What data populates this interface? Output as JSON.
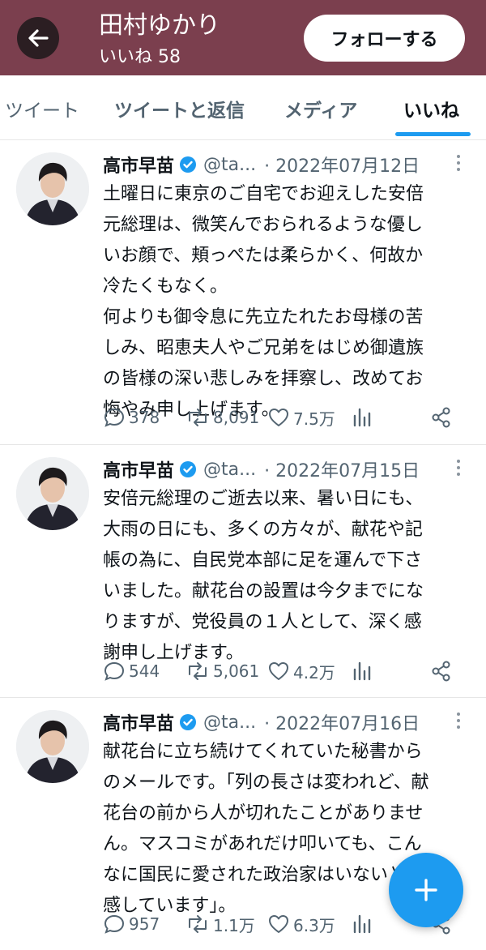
{
  "header": {
    "user_name": "田村ゆかり",
    "likes_count_label": "いいね 58",
    "follow_label": "フォローする",
    "color": "#7b3f4e"
  },
  "tabs": [
    {
      "label": "ツイート",
      "active": false
    },
    {
      "label": "ツイートと返信",
      "active": false
    },
    {
      "label": "メディア",
      "active": false
    },
    {
      "label": "いいね",
      "active": true
    }
  ],
  "tweets": [
    {
      "name": "高市早苗",
      "handle": "@ta...",
      "date": "· 2022年07月12日",
      "text": "土曜日に東京のご自宅でお迎えした安倍\n元総理は、微笑んでおられるような優し\nいお顔で、頬っぺたは柔らかく、何故か\n冷たくもなく。\n何よりも御令息に先立たれたお母様の苦\nしみ、昭恵夫人やご兄弟をはじめ御遺族\nの皆様の深い悲しみを拝察し、改めてお\n悔やみ申し上げます。",
      "replies": "378",
      "retweets": "8,091",
      "likes": "7.5万"
    },
    {
      "name": "高市早苗",
      "handle": "@ta...",
      "date": "· 2022年07月15日",
      "text": "安倍元総理のご逝去以来、暑い日にも、\n大雨の日にも、多くの方々が、献花や記\n帳の為に、自民党本部に足を運んで下さ\nいました。献花台の設置は今夕までにな\nりますが、党役員の１人として、深く感\n謝申し上げます。",
      "replies": "544",
      "retweets": "5,061",
      "likes": "4.2万"
    },
    {
      "name": "高市早苗",
      "handle": "@ta...",
      "date": "· 2022年07月16日",
      "text": "献花台に立ち続けてくれていた秘書から\nのメールです。「列の長さは変われど、献\n花台の前から人が切れたことがありませ\nん。マスコミがあれだけ叩いても、こん\nなに国民に愛された政治家はいないと実\n感しています」。",
      "replies": "957",
      "retweets": "1.1万",
      "likes": "6.3万"
    }
  ],
  "icons": {
    "back": "arrow-left-icon",
    "verified": "verified-badge-icon",
    "reply": "speech-bubble-icon",
    "retweet": "retweet-icon",
    "like": "heart-icon",
    "analytics": "bar-chart-icon",
    "share": "share-icon",
    "more": "vertical-dots-icon",
    "compose": "plus-icon"
  },
  "colors": {
    "accent": "#1d9bf0",
    "secondary_text": "#536471"
  }
}
